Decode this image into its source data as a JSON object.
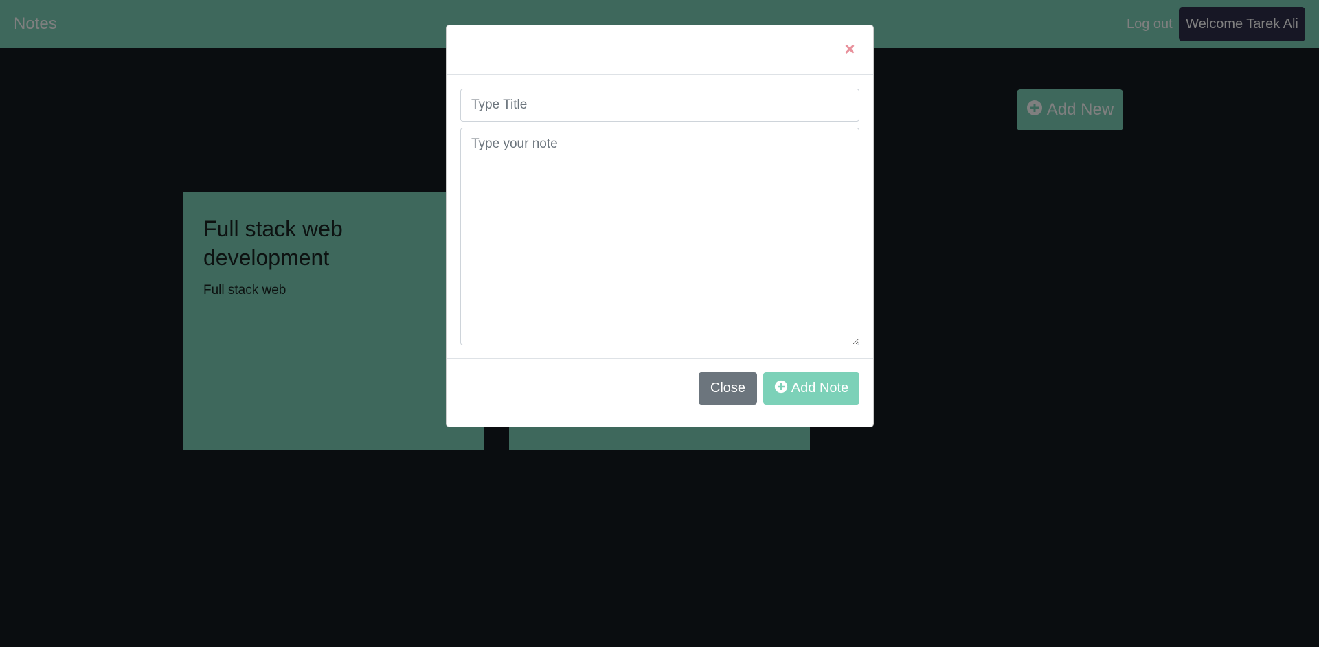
{
  "navbar": {
    "brand": "Notes",
    "logout_label": "Log out",
    "welcome_label": "Welcome Tarek Ali"
  },
  "actions": {
    "add_new_label": "Add New"
  },
  "notes": [
    {
      "title": "Full stack web development",
      "body": "Full stack web"
    },
    {
      "title": "",
      "body": ""
    }
  ],
  "modal": {
    "close_icon": "×",
    "title_placeholder": "Type Title",
    "note_placeholder": "Type your note",
    "close_label": "Close",
    "add_note_label": "Add Note"
  },
  "icons": {
    "add_new": "plus-circle-icon",
    "add_note": "plus-circle-icon",
    "modal_close": "close-icon"
  },
  "colors": {
    "accent": "#7cd1b8",
    "page_background": "#151b20",
    "welcome_badge": "#2e2e4a",
    "close_button": "#6c757d",
    "close_icon": "#e8909b"
  }
}
